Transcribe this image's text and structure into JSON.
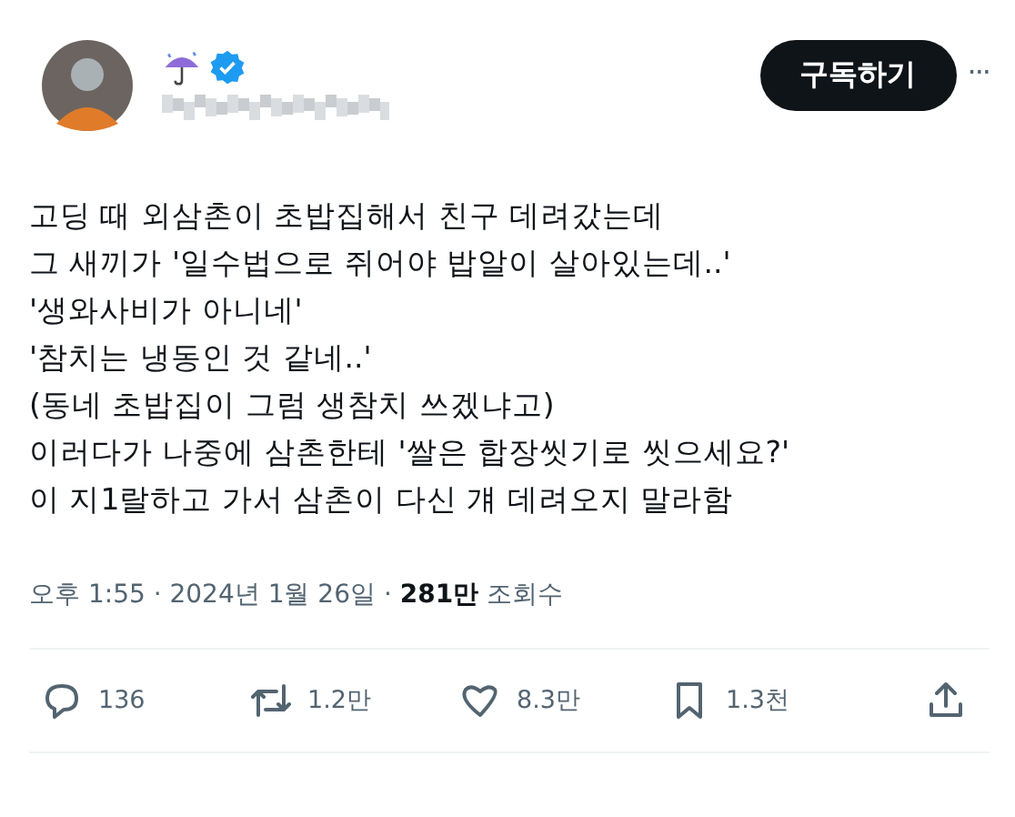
{
  "author": {
    "verified": true
  },
  "subscribe_button": "구독하기",
  "more_button": "···",
  "body_lines": [
    "고딩 때 외삼촌이 초밥집해서 친구 데려갔는데",
    "그 새끼가 '일수법으로 쥐어야 밥알이 살아있는데..'",
    "'생와사비가 아니네'",
    "'참치는 냉동인 것 같네..'",
    "(동네 초밥집이 그럼 생참치 쓰겠냐고)",
    "이러다가 나중에 삼촌한테 '쌀은 합장씻기로 씻으세요?'",
    "이 지1랄하고 가서 삼촌이 다신 걔 데려오지 말라함"
  ],
  "meta": "오후 1:55 · 2024년 1월 26일 · **281만** 조회수",
  "actions": [
    {
      "kind": "reply",
      "count": "136"
    },
    {
      "kind": "repost",
      "count": "1.2만"
    },
    {
      "kind": "like",
      "count": "8.3만"
    },
    {
      "kind": "bookmark",
      "count": "1.3천"
    },
    {
      "kind": "share"
    }
  ]
}
